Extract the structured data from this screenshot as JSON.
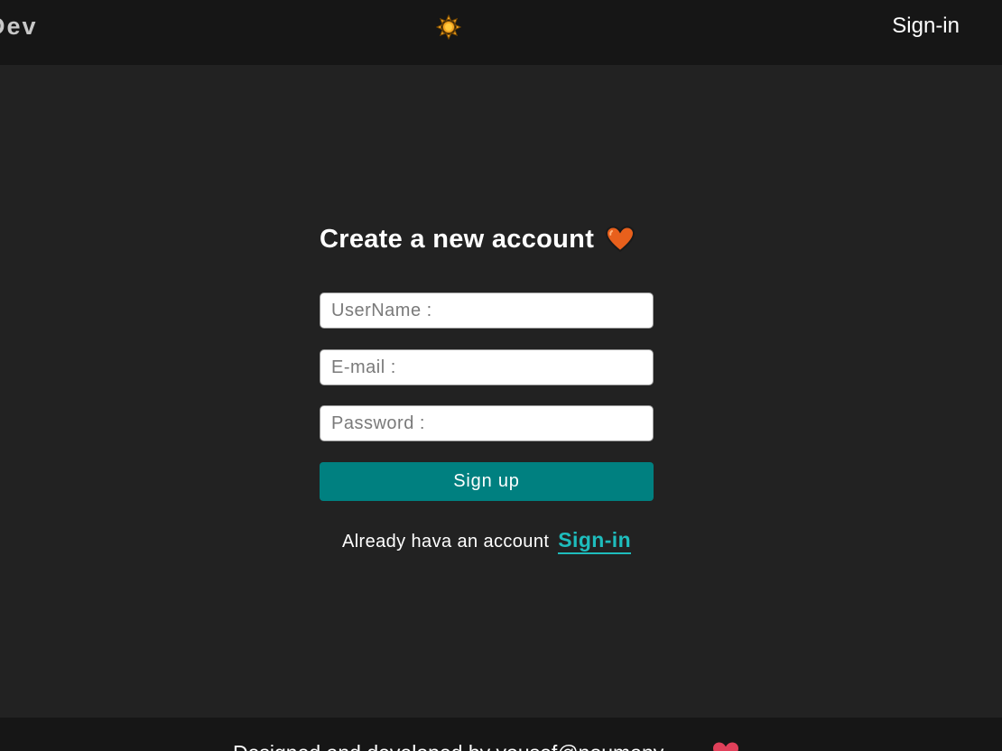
{
  "header": {
    "brand": "Dev",
    "theme_icon": "sun-icon",
    "signin_label": "Sign-in"
  },
  "form": {
    "title": "Create a new account",
    "title_icon": "heart-icon",
    "username_placeholder": "UserName :",
    "email_placeholder": "E-mail :",
    "password_placeholder": "Password :",
    "username_value": "",
    "email_value": "",
    "password_value": "",
    "submit_label": "Sign up",
    "already_text": "Already hava an account",
    "signin_link": "Sign-in"
  },
  "footer": {
    "text": "Designed and developed by yousef@noumany",
    "icon": "heart-icon"
  },
  "colors": {
    "background": "#222222",
    "header_bg": "#161616",
    "accent": "#008080",
    "link": "#1ebdbd",
    "title_heart": "#e8601c",
    "footer_heart": "#e0405a",
    "sun": "#f5a623"
  }
}
